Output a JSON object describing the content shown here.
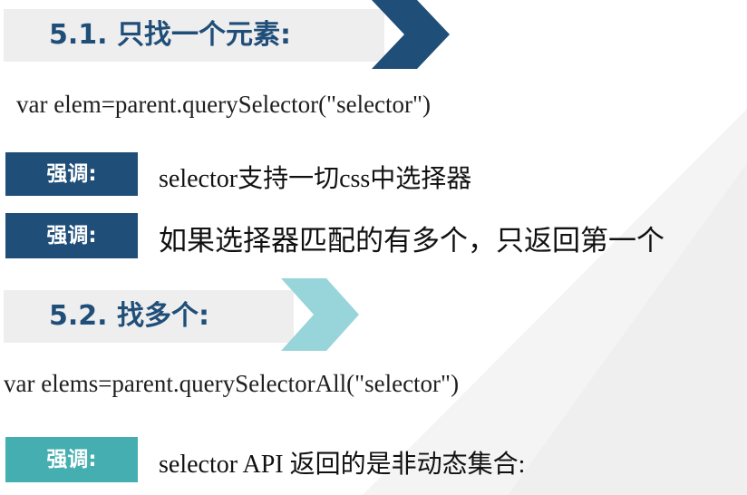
{
  "section1": {
    "title": "5.1. 只找一个元素:",
    "code": "var elem=parent.querySelector(\"selector\")",
    "notes": [
      {
        "badge": "强调:",
        "text": "selector支持一切css中选择器"
      },
      {
        "badge": "强调:",
        "text": "如果选择器匹配的有多个，只返回第一个"
      }
    ]
  },
  "section2": {
    "title": "5.2. 找多个:",
    "code": "var elems=parent.querySelectorAll(\"selector\")",
    "notes": [
      {
        "badge": "强调:",
        "text": "selector API 返回的是非动态集合:"
      }
    ]
  },
  "colors": {
    "dark_blue": "#1f4e79",
    "teal": "#45aeb0",
    "light_teal": "#97d5da",
    "header_bg": "#efeeee"
  }
}
